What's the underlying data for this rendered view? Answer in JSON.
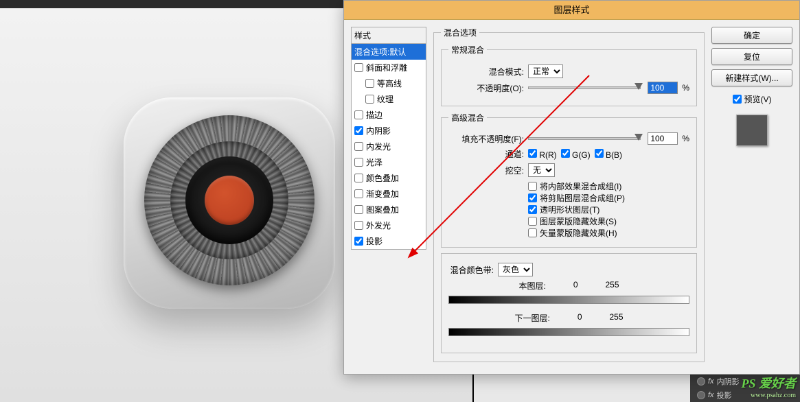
{
  "dialog": {
    "title": "图层样式",
    "styles_header": "样式",
    "styles": [
      {
        "label": "混合选项:默认",
        "checkbox": false,
        "checked": false,
        "selected": true,
        "indent": false
      },
      {
        "label": "斜面和浮雕",
        "checkbox": true,
        "checked": false,
        "indent": false
      },
      {
        "label": "等高线",
        "checkbox": true,
        "checked": false,
        "indent": true
      },
      {
        "label": "纹理",
        "checkbox": true,
        "checked": false,
        "indent": true
      },
      {
        "label": "描边",
        "checkbox": true,
        "checked": false,
        "indent": false
      },
      {
        "label": "内阴影",
        "checkbox": true,
        "checked": true,
        "indent": false
      },
      {
        "label": "内发光",
        "checkbox": true,
        "checked": false,
        "indent": false
      },
      {
        "label": "光泽",
        "checkbox": true,
        "checked": false,
        "indent": false
      },
      {
        "label": "颜色叠加",
        "checkbox": true,
        "checked": false,
        "indent": false
      },
      {
        "label": "渐变叠加",
        "checkbox": true,
        "checked": false,
        "indent": false
      },
      {
        "label": "图案叠加",
        "checkbox": true,
        "checked": false,
        "indent": false
      },
      {
        "label": "外发光",
        "checkbox": true,
        "checked": false,
        "indent": false
      },
      {
        "label": "投影",
        "checkbox": true,
        "checked": true,
        "indent": false
      }
    ],
    "blend_options": {
      "section": "混合选项",
      "general": {
        "title": "常规混合",
        "mode_label": "混合模式:",
        "mode_value": "正常",
        "opacity_label": "不透明度(O):",
        "opacity_value": "100",
        "pct": "%"
      },
      "advanced": {
        "title": "高级混合",
        "fill_label": "填充不透明度(F):",
        "fill_value": "100",
        "pct": "%",
        "channels_label": "通道:",
        "r": "R(R)",
        "g": "G(G)",
        "b": "B(B)",
        "knockout_label": "挖空:",
        "knockout_value": "无",
        "cb1": "将内部效果混合成组(I)",
        "cb2": "将剪贴图层混合成组(P)",
        "cb3": "透明形状图层(T)",
        "cb4": "图层蒙版隐藏效果(S)",
        "cb5": "矢量蒙版隐藏效果(H)"
      },
      "blendif": {
        "title": "混合颜色带:",
        "channel": "灰色",
        "this_label": "本图层:",
        "under_label": "下一图层:",
        "v0": "0",
        "v255": "255"
      }
    },
    "buttons": {
      "ok": "确定",
      "cancel": "复位",
      "newstyle": "新建样式(W)...",
      "preview": "预览(V)"
    }
  },
  "layers": {
    "fx_rows": [
      "内阴影",
      "投影"
    ]
  },
  "watermark": {
    "text": "PS 爱好者",
    "url": "www.psahz.com"
  }
}
